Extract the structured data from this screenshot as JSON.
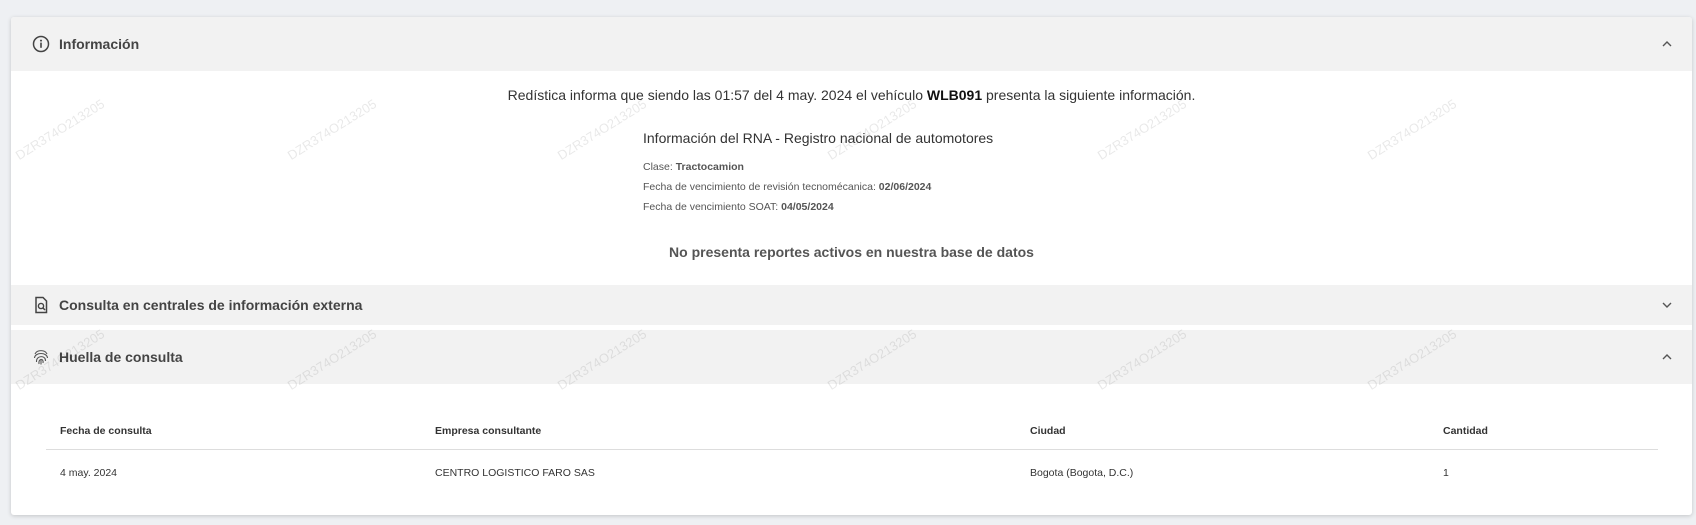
{
  "sections": {
    "info": {
      "title": "Información"
    },
    "external": {
      "title": "Consulta en centrales de información externa"
    },
    "huella": {
      "title": "Huella de consulta"
    }
  },
  "summary": {
    "prefix": "Redística informa que siendo las 01:57 del 4 may. 2024 el vehículo ",
    "plate": "WLB091",
    "suffix": " presenta la siguiente información."
  },
  "rna": {
    "title": "Información del RNA - Registro nacional de automotores",
    "clase_label": "Clase: ",
    "clase_value": "Tractocamion",
    "tecno_label": "Fecha de vencimiento de revisión tecnomécanica: ",
    "tecno_value": "02/06/2024",
    "soat_label": "Fecha de vencimiento SOAT: ",
    "soat_value": "04/05/2024"
  },
  "no_reports": "No presenta reportes activos en nuestra base de datos",
  "table": {
    "headers": [
      "Fecha de consulta",
      "Empresa consultante",
      "Ciudad",
      "Cantidad"
    ],
    "rows": [
      [
        "4 may. 2024",
        "CENTRO LOGISTICO FARO SAS",
        "Bogota (Bogota, D.C.)",
        "1"
      ]
    ]
  },
  "watermark": "DZR374O213205",
  "icons": {
    "info": "info-circle-icon",
    "external": "document-search-icon",
    "huella": "fingerprint-icon",
    "expand": "chevron-up-icon",
    "collapse": "chevron-down-icon"
  }
}
